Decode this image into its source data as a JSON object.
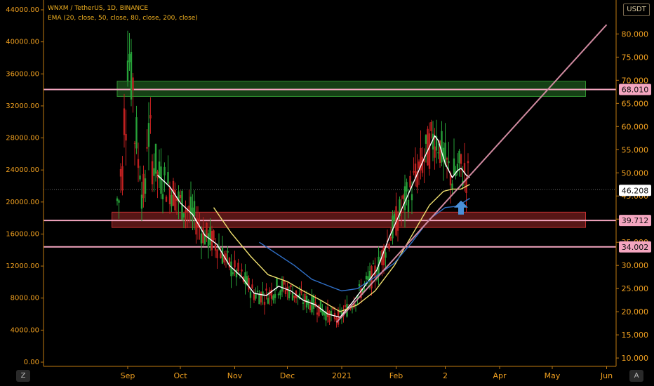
{
  "header": {
    "title": "WNXM / TetherUS, 1D, BINANCE",
    "indicator": "EMA (20, close, 50, close, 80, close, 200, close)"
  },
  "currency_badge": "USDT",
  "buttons": {
    "left": "Z",
    "right": "A"
  },
  "colors": {
    "axis_text": "#f0a020",
    "ema20": "#ffffff",
    "ema50": "#f0e070",
    "ema80": "#3070c8",
    "trendline": "#d08aa0",
    "horizontal_line": "#f4a6c0",
    "resistance_zone": "#2f8f2f",
    "support_zone": "#c03030",
    "bull": "#26a038",
    "bear": "#c02020",
    "arrow": "#4a90d9"
  },
  "chart_data": {
    "type": "candlestick",
    "left_axis": {
      "ticks": [
        "0.00",
        "4000.00",
        "8000.00",
        "12000.00",
        "16000.00",
        "20000.00",
        "24000.00",
        "28000.00",
        "32000.00",
        "36000.00",
        "40000.00",
        "44000.00"
      ],
      "values": [
        0,
        4000,
        8000,
        12000,
        16000,
        20000,
        24000,
        28000,
        32000,
        36000,
        40000,
        44000
      ]
    },
    "right_axis": {
      "unit": "USDT",
      "ticks": [
        "10.000",
        "15.000",
        "20.000",
        "25.000",
        "30.000",
        "35.000",
        "40.000",
        "45.000",
        "50.000",
        "55.000",
        "60.000",
        "65.000",
        "70.000",
        "75.000",
        "80.000"
      ],
      "values": [
        10,
        15,
        20,
        25,
        30,
        35,
        40,
        45,
        50,
        55,
        60,
        65,
        70,
        75,
        80
      ],
      "range": [
        8.5,
        84
      ]
    },
    "x_axis": {
      "labels": [
        "Sep",
        "Oct",
        "Nov",
        "Dec",
        "2021",
        "Feb",
        "2",
        "Apr",
        "May",
        "Jun"
      ],
      "dates": [
        "2020-09-01",
        "2020-10-01",
        "2020-11-01",
        "2020-12-01",
        "2021-01-01",
        "2021-02-01",
        "2021-03-01",
        "2021-04-01",
        "2021-05-01",
        "2021-06-01"
      ]
    },
    "price_labels": [
      {
        "value": 68.01,
        "text": "68.010",
        "kind": "level"
      },
      {
        "value": 46.208,
        "text": "46.208",
        "kind": "current"
      },
      {
        "value": 39.712,
        "text": "39.712",
        "kind": "level"
      },
      {
        "value": 34.002,
        "text": "34.002",
        "kind": "level"
      }
    ],
    "current_price": 46.208,
    "horizontal_levels": [
      68.01,
      39.712,
      34.002
    ],
    "zones": [
      {
        "type": "resistance",
        "from": "2020-08-26",
        "to": "2021-05-20",
        "low": 66.5,
        "high": 69.8
      },
      {
        "type": "support",
        "from": "2020-08-23",
        "to": "2021-05-20",
        "low": 38.2,
        "high": 41.5
      }
    ],
    "trendline": {
      "start": {
        "date": "2020-12-29",
        "value": 17.7
      },
      "end": {
        "date": "2021-06-01",
        "value": 82
      }
    },
    "annotations": [
      {
        "type": "up-arrow",
        "date": "2021-03-10",
        "value": 42.5
      }
    ],
    "ema_series": [
      {
        "period": 20,
        "color": "#ffffff",
        "points": [
          [
            "2020-09-18",
            49.5
          ],
          [
            "2020-09-25",
            47.0
          ],
          [
            "2020-10-01",
            43.5
          ],
          [
            "2020-10-08",
            41.0
          ],
          [
            "2020-10-15",
            36.5
          ],
          [
            "2020-10-22",
            34.5
          ],
          [
            "2020-10-29",
            30.0
          ],
          [
            "2020-11-05",
            27.5
          ],
          [
            "2020-11-12",
            24.0
          ],
          [
            "2020-11-19",
            23.5
          ],
          [
            "2020-11-26",
            25.5
          ],
          [
            "2020-12-03",
            24.5
          ],
          [
            "2020-12-10",
            22.5
          ],
          [
            "2020-12-17",
            21.5
          ],
          [
            "2020-12-24",
            19.5
          ],
          [
            "2020-12-31",
            18.8
          ],
          [
            "2021-01-07",
            22.0
          ],
          [
            "2021-01-14",
            25.5
          ],
          [
            "2021-01-21",
            29.0
          ],
          [
            "2021-01-28",
            36.0
          ],
          [
            "2021-02-04",
            42.0
          ],
          [
            "2021-02-11",
            48.0
          ],
          [
            "2021-02-18",
            54.0
          ],
          [
            "2021-02-23",
            58.0
          ],
          [
            "2021-02-25",
            57.0
          ],
          [
            "2021-03-01",
            52.0
          ],
          [
            "2021-03-05",
            49.0
          ],
          [
            "2021-03-08",
            50.5
          ],
          [
            "2021-03-10",
            51.0
          ],
          [
            "2021-03-13",
            49.5
          ],
          [
            "2021-03-15",
            49.0
          ]
        ]
      },
      {
        "period": 50,
        "color": "#f0e070",
        "points": [
          [
            "2020-10-20",
            42.5
          ],
          [
            "2020-10-30",
            37.0
          ],
          [
            "2020-11-10",
            32.0
          ],
          [
            "2020-11-20",
            28.0
          ],
          [
            "2020-12-01",
            26.5
          ],
          [
            "2020-12-10",
            24.5
          ],
          [
            "2020-12-20",
            22.5
          ],
          [
            "2020-12-31",
            20.0
          ],
          [
            "2021-01-10",
            21.5
          ],
          [
            "2021-01-20",
            24.5
          ],
          [
            "2021-01-31",
            30.0
          ],
          [
            "2021-02-10",
            36.5
          ],
          [
            "2021-02-20",
            43.0
          ],
          [
            "2021-02-28",
            46.0
          ],
          [
            "2021-03-05",
            46.5
          ],
          [
            "2021-03-10",
            46.5
          ],
          [
            "2021-03-15",
            47.5
          ]
        ]
      },
      {
        "period": 80,
        "color": "#3070c8",
        "points": [
          [
            "2020-11-15",
            35.0
          ],
          [
            "2020-11-25",
            32.5
          ],
          [
            "2020-12-05",
            30.0
          ],
          [
            "2020-12-15",
            27.0
          ],
          [
            "2020-12-25",
            25.5
          ],
          [
            "2021-01-01",
            24.5
          ],
          [
            "2021-01-10",
            25.0
          ],
          [
            "2021-01-20",
            27.5
          ],
          [
            "2021-01-31",
            30.5
          ],
          [
            "2021-02-10",
            35.0
          ],
          [
            "2021-02-20",
            40.0
          ],
          [
            "2021-03-01",
            42.5
          ],
          [
            "2021-03-08",
            42.8
          ],
          [
            "2021-03-15",
            44.5
          ]
        ]
      }
    ]
  }
}
